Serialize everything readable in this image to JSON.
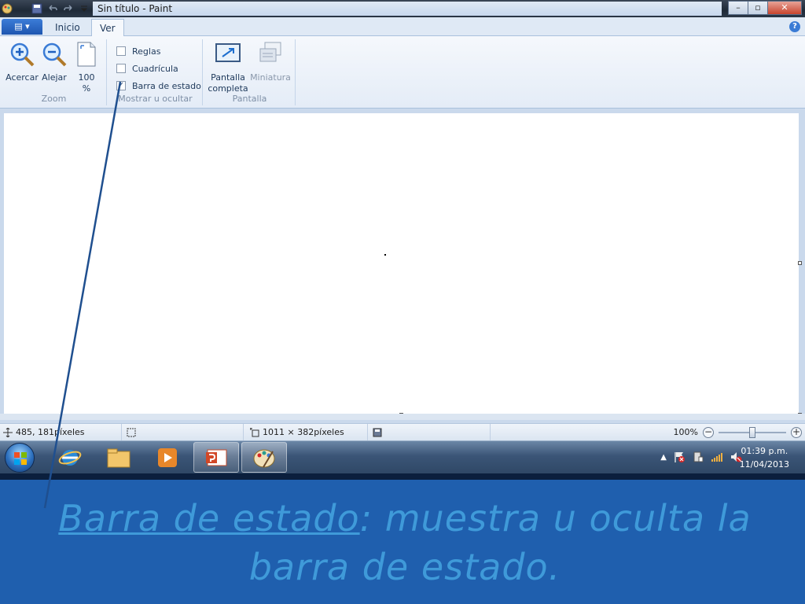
{
  "window": {
    "title": "Sin título - Paint",
    "minimize": "–",
    "maximize": "▫",
    "close": "✕"
  },
  "ribbon": {
    "app_menu_label": "▤ ▾",
    "tabs": [
      {
        "label": "Inicio",
        "active": false
      },
      {
        "label": "Ver",
        "active": true
      }
    ],
    "help": "?",
    "groups": {
      "zoom": {
        "label": "Zoom",
        "buttons": [
          {
            "label": "Acercar",
            "icon": "zoom-in-icon"
          },
          {
            "label": "Alejar",
            "icon": "zoom-out-icon"
          },
          {
            "label": "100 %",
            "icon": "actual-size-icon"
          }
        ]
      },
      "show_hide": {
        "label": "Mostrar u ocultar",
        "checkboxes": [
          {
            "label": "Reglas",
            "checked": false
          },
          {
            "label": "Cuadrícula",
            "checked": false
          },
          {
            "label": "Barra de estado",
            "checked": true
          }
        ],
        "check_mark": "✓"
      },
      "display": {
        "label": "Pantalla",
        "buttons": [
          {
            "label": "Pantalla completa",
            "icon": "full-screen-icon",
            "enabled": true
          },
          {
            "label": "Miniatura",
            "icon": "thumbnail-icon",
            "enabled": false
          }
        ]
      }
    }
  },
  "statusbar": {
    "cursor_position": "485, 181píxeles",
    "selection_size": "",
    "canvas_size": "1011 × 382píxeles",
    "zoom_level": "100%",
    "zoom_minus": "−",
    "zoom_plus": "+",
    "zoom_fraction": 0.5
  },
  "taskbar": {
    "clock_time": "01:39 p.m.",
    "clock_date": "11/04/2013",
    "tray_arrow": "▲",
    "apps": [
      {
        "name": "internet-explorer",
        "open": false
      },
      {
        "name": "windows-explorer",
        "open": false
      },
      {
        "name": "media-player",
        "open": false
      },
      {
        "name": "powerpoint",
        "open": true
      },
      {
        "name": "paint",
        "open": true
      }
    ]
  },
  "caption": {
    "term": "Barra de estado",
    "separator": ":",
    "description": " muestra u oculta la barra de estado."
  },
  "colors": {
    "caption_text": "#3f9ad9",
    "caption_background": "#1f5fae",
    "pointer_line": "#1f4f8f"
  }
}
